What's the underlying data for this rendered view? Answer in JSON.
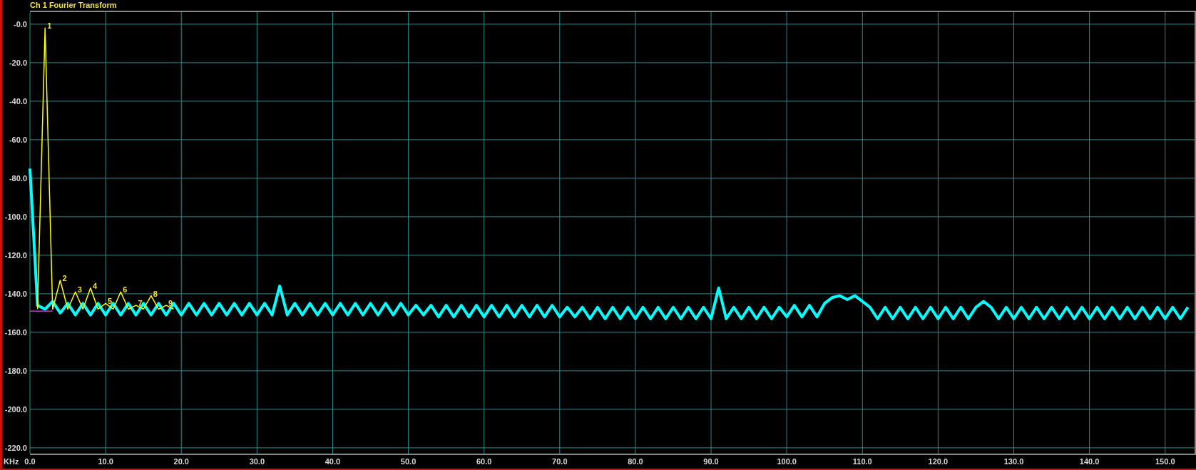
{
  "chart_data": {
    "type": "line",
    "grid": true,
    "title": "Ch 1 Fourier Transform",
    "xlabel": "KHz",
    "xlim": [
      0,
      153.7
    ],
    "ylim": [
      -223,
      7
    ],
    "xticks": [
      {
        "value": 0,
        "label": "0.0"
      },
      {
        "value": 10,
        "label": "10.0"
      },
      {
        "value": 20,
        "label": "20.0"
      },
      {
        "value": 30,
        "label": "30.0"
      },
      {
        "value": 40,
        "label": "40.0"
      },
      {
        "value": 50,
        "label": "50.0"
      },
      {
        "value": 60,
        "label": "60.0"
      },
      {
        "value": 70,
        "label": "70.0"
      },
      {
        "value": 80,
        "label": "80.0"
      },
      {
        "value": 90,
        "label": "90.0"
      },
      {
        "value": 100,
        "label": "100.0"
      },
      {
        "value": 110,
        "label": "110.0"
      },
      {
        "value": 120,
        "label": "120.0"
      },
      {
        "value": 130,
        "label": "130.0"
      },
      {
        "value": 140,
        "label": "140.0"
      },
      {
        "value": 150,
        "label": "150.0"
      }
    ],
    "yticks": [
      {
        "value": 0,
        "label": "-0.0"
      },
      {
        "value": -20,
        "label": "-20.0"
      },
      {
        "value": -40,
        "label": "-40.0"
      },
      {
        "value": -60,
        "label": "-60.0"
      },
      {
        "value": -80,
        "label": "-80.0"
      },
      {
        "value": -100,
        "label": "-100.0"
      },
      {
        "value": -120,
        "label": "-120.0"
      },
      {
        "value": -140,
        "label": "-140.0"
      },
      {
        "value": -160,
        "label": "-160.0"
      },
      {
        "value": -180,
        "label": "-180.0"
      },
      {
        "value": -200,
        "label": "-200.0"
      },
      {
        "value": -220,
        "label": "-220.0"
      }
    ],
    "x": [
      0,
      1,
      2,
      3,
      4,
      5,
      6,
      7,
      8,
      9,
      10,
      11,
      12,
      13,
      14,
      15,
      16,
      17,
      18,
      19,
      20,
      21,
      22,
      23,
      24,
      25,
      26,
      27,
      28,
      29,
      30,
      31,
      32,
      33,
      34,
      35,
      36,
      37,
      38,
      39,
      40,
      41,
      42,
      43,
      44,
      45,
      46,
      47,
      48,
      49,
      50,
      51,
      52,
      53,
      54,
      55,
      56,
      57,
      58,
      59,
      60,
      61,
      62,
      63,
      64,
      65,
      66,
      67,
      68,
      69,
      70,
      71,
      72,
      73,
      74,
      75,
      76,
      77,
      78,
      79,
      80,
      81,
      82,
      83,
      84,
      85,
      86,
      87,
      88,
      89,
      90,
      91,
      92,
      93,
      94,
      95,
      96,
      97,
      98,
      99,
      100,
      101,
      102,
      103,
      104,
      105,
      106,
      107,
      108,
      109,
      110,
      111,
      112,
      113,
      114,
      115,
      116,
      117,
      118,
      119,
      120,
      121,
      122,
      123,
      124,
      125,
      126,
      127,
      128,
      129,
      130,
      131,
      132,
      133,
      134,
      135,
      136,
      137,
      138,
      139,
      140,
      141,
      142,
      143,
      144,
      145,
      146,
      147,
      148,
      149,
      150,
      151,
      152,
      153
    ],
    "series": [
      {
        "color": "#00ffff",
        "values": [
          -75,
          -146,
          -148,
          -144,
          -150,
          -145,
          -151,
          -145,
          -151,
          -145,
          -151,
          -145,
          -151,
          -145,
          -151,
          -145,
          -151,
          -145,
          -151,
          -145,
          -151,
          -145,
          -151,
          -145,
          -151,
          -145,
          -151,
          -145,
          -151,
          -145,
          -151,
          -145,
          -151,
          -136,
          -151,
          -145,
          -151,
          -145,
          -151,
          -145,
          -151,
          -145,
          -151,
          -145,
          -151,
          -145,
          -151,
          -145,
          -151,
          -145,
          -151,
          -146,
          -151,
          -146,
          -152,
          -146,
          -152,
          -146,
          -152,
          -146,
          -152,
          -146,
          -152,
          -146,
          -152,
          -146,
          -152,
          -146,
          -152,
          -146,
          -152,
          -147,
          -152,
          -147,
          -153,
          -147,
          -153,
          -147,
          -153,
          -147,
          -153,
          -147,
          -153,
          -147,
          -153,
          -147,
          -153,
          -147,
          -153,
          -147,
          -153,
          -137,
          -153,
          -147,
          -153,
          -147,
          -153,
          -147,
          -153,
          -147,
          -152,
          -146,
          -152,
          -146,
          -152,
          -145,
          -142,
          -141,
          -143,
          -141,
          -144,
          -147,
          -153,
          -147,
          -153,
          -147,
          -153,
          -147,
          -153,
          -147,
          -153,
          -147,
          -153,
          -147,
          -153,
          -147,
          -144,
          -147,
          -153,
          -147,
          -153,
          -147,
          -153,
          -147,
          -153,
          -147,
          -153,
          -147,
          -153,
          -147,
          -153,
          -147,
          -153,
          -147,
          -153,
          -147,
          -153,
          -147,
          -153,
          -147,
          -153,
          -147,
          -153,
          -147
        ]
      },
      {
        "color": "#ffff00",
        "values": [
          null,
          -148,
          -2,
          -148,
          -133,
          -148,
          -139,
          -148,
          -137,
          -148,
          -145,
          -148,
          -139,
          -148,
          -146,
          -148,
          -141,
          -148,
          -146,
          -148,
          null,
          null,
          null,
          null,
          null,
          null,
          null,
          null,
          null,
          null,
          null,
          null,
          null,
          null,
          null,
          null,
          null,
          null,
          null,
          null,
          null,
          null,
          null,
          null,
          null,
          null,
          null,
          null,
          null,
          null,
          null,
          null,
          null,
          null,
          null,
          null,
          null,
          null,
          null,
          null,
          null,
          null,
          null,
          null,
          null,
          null,
          null,
          null,
          null,
          null,
          null,
          null,
          null,
          null,
          null,
          null,
          null,
          null,
          null,
          null,
          null,
          null,
          null,
          null,
          null,
          null,
          null,
          null,
          null,
          null,
          null,
          null,
          null,
          null,
          null,
          null,
          null,
          null,
          null,
          null,
          null,
          null,
          null,
          null,
          null,
          null,
          null,
          null,
          null,
          null,
          null,
          null,
          null,
          null,
          null,
          null,
          null,
          null,
          null,
          null,
          null,
          null,
          null,
          null,
          null,
          null,
          null,
          null,
          null,
          null,
          null,
          null,
          null,
          null,
          null,
          null,
          null,
          null,
          null,
          null,
          null,
          null,
          null,
          null,
          null,
          null,
          null,
          null,
          null,
          null,
          null,
          null,
          null,
          null
        ]
      }
    ],
    "annotations": [
      {
        "text": "1",
        "x": 2,
        "y": -2
      },
      {
        "text": "2",
        "x": 4,
        "y": -133
      },
      {
        "text": "3",
        "x": 6,
        "y": -139
      },
      {
        "text": "4",
        "x": 8,
        "y": -137
      },
      {
        "text": "5",
        "x": 10,
        "y": -145
      },
      {
        "text": "6",
        "x": 12,
        "y": -139
      },
      {
        "text": "7",
        "x": 14,
        "y": -146
      },
      {
        "text": "8",
        "x": 16,
        "y": -141
      },
      {
        "text": "9",
        "x": 18,
        "y": -146
      }
    ]
  }
}
